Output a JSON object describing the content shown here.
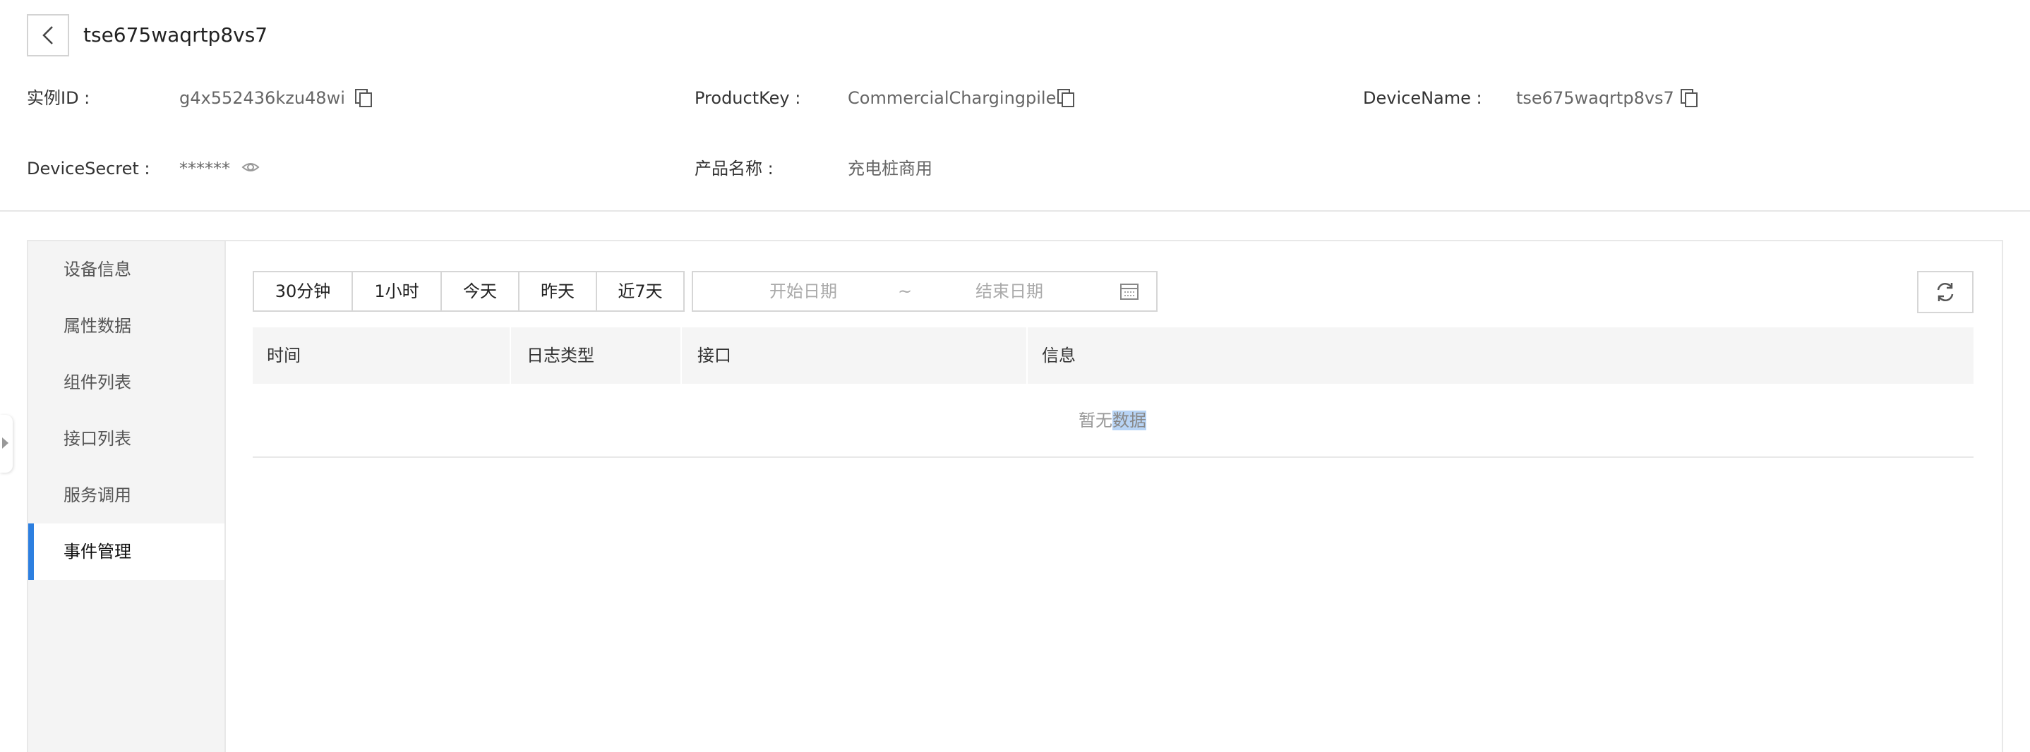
{
  "header": {
    "device_title": "tse675waqrtp8vs7"
  },
  "info": {
    "instance_id_label": "实例ID :",
    "instance_id_value": "g4x552436kzu48wi",
    "product_key_label": "ProductKey :",
    "product_key_value": "CommercialChargingpile",
    "device_name_label": "DeviceName :",
    "device_name_value": "tse675waqrtp8vs7",
    "device_secret_label": "DeviceSecret :",
    "device_secret_value": "******",
    "product_name_label": "产品名称 :",
    "product_name_value": "充电桩商用"
  },
  "sidebar": {
    "items": [
      {
        "label": "设备信息"
      },
      {
        "label": "属性数据"
      },
      {
        "label": "组件列表"
      },
      {
        "label": "接口列表"
      },
      {
        "label": "服务调用"
      },
      {
        "label": "事件管理"
      }
    ],
    "active_index": 5
  },
  "filters": {
    "time_buttons": [
      {
        "label": "30分钟"
      },
      {
        "label": "1小时"
      },
      {
        "label": "今天"
      },
      {
        "label": "昨天"
      },
      {
        "label": "近7天"
      }
    ],
    "start_placeholder": "开始日期",
    "separator": "~",
    "end_placeholder": "结束日期"
  },
  "table": {
    "columns": [
      {
        "label": "时间"
      },
      {
        "label": "日志类型"
      },
      {
        "label": "接口"
      },
      {
        "label": "信息"
      }
    ],
    "empty_prefix": "暂无",
    "empty_highlight": "数据"
  },
  "colors": {
    "accent": "#2d7fe0",
    "selection": "#b8d4f5"
  }
}
